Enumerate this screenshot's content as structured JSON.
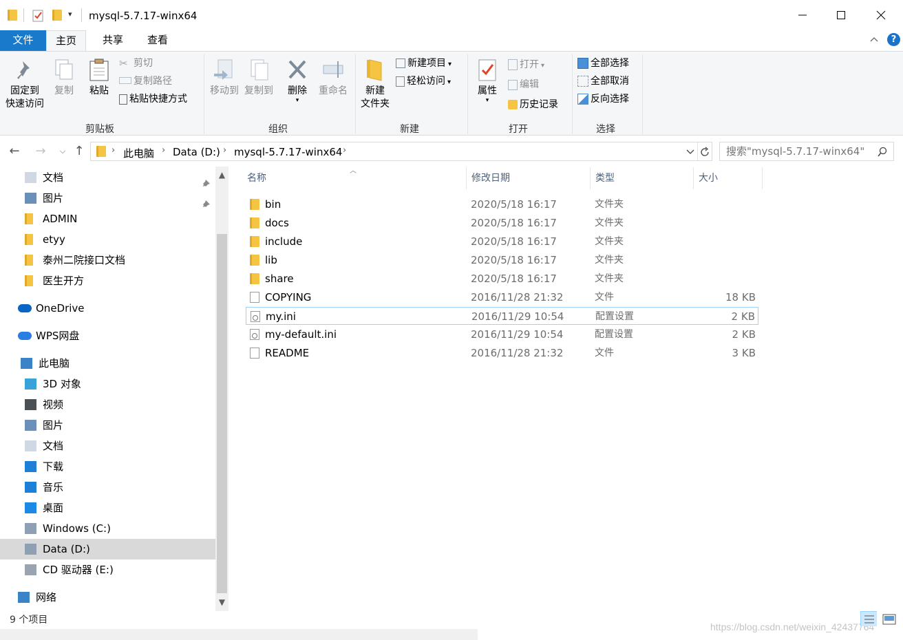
{
  "window": {
    "title": "mysql-5.7.17-winx64",
    "minimize_icon": "minimize-icon",
    "maximize_icon": "maximize-icon",
    "close_icon": "close-icon"
  },
  "tabs": {
    "file": "文件",
    "home": "主页",
    "share": "共享",
    "view": "查看",
    "help": "?"
  },
  "ribbon": {
    "clipboard": {
      "label": "剪贴板",
      "pin_line1": "固定到",
      "pin_line2": "快速访问",
      "copy": "复制",
      "paste": "粘贴",
      "cut": "剪切",
      "copy_path": "复制路径",
      "paste_shortcut": "粘贴快捷方式"
    },
    "organize": {
      "label": "组织",
      "move_to": "移动到",
      "copy_to": "复制到",
      "delete": "删除",
      "rename": "重命名"
    },
    "new": {
      "label": "新建",
      "new_folder_line1": "新建",
      "new_folder_line2": "文件夹",
      "new_item": "新建项目",
      "easy_access": "轻松访问"
    },
    "open": {
      "label": "打开",
      "properties": "属性",
      "open": "打开",
      "edit": "编辑",
      "history": "历史记录"
    },
    "select": {
      "label": "选择",
      "select_all": "全部选择",
      "select_none": "全部取消",
      "invert": "反向选择"
    }
  },
  "address": {
    "crumbs": [
      "此电脑",
      "Data (D:)",
      "mysql-5.7.17-winx64"
    ],
    "search_placeholder": "搜索\"mysql-5.7.17-winx64\""
  },
  "nav": {
    "items": [
      {
        "label": "文档",
        "icon": "documents-icon",
        "pinned": true
      },
      {
        "label": "图片",
        "icon": "pictures-icon",
        "pinned": true
      },
      {
        "label": "ADMIN",
        "icon": "folder-icon"
      },
      {
        "label": "etyy",
        "icon": "folder-icon"
      },
      {
        "label": "泰州二院接口文档",
        "icon": "folder-icon"
      },
      {
        "label": "医生开方",
        "icon": "folder-icon"
      },
      {
        "label": "OneDrive",
        "icon": "onedrive-icon"
      },
      {
        "label": "WPS网盘",
        "icon": "cloud-icon"
      },
      {
        "label": "此电脑",
        "icon": "computer-icon"
      },
      {
        "label": "3D 对象",
        "icon": "3d-objects-icon"
      },
      {
        "label": "视频",
        "icon": "videos-icon"
      },
      {
        "label": "图片",
        "icon": "pictures-icon"
      },
      {
        "label": "文档",
        "icon": "documents-icon"
      },
      {
        "label": "下载",
        "icon": "downloads-icon"
      },
      {
        "label": "音乐",
        "icon": "music-icon"
      },
      {
        "label": "桌面",
        "icon": "desktop-icon"
      },
      {
        "label": "Windows (C:)",
        "icon": "drive-c-icon"
      },
      {
        "label": "Data (D:)",
        "icon": "drive-d-icon",
        "selected": true
      },
      {
        "label": "CD 驱动器 (E:)",
        "icon": "cd-drive-icon"
      },
      {
        "label": "网络",
        "icon": "network-icon"
      }
    ]
  },
  "columns": {
    "name": "名称",
    "date": "修改日期",
    "type": "类型",
    "size": "大小"
  },
  "files": [
    {
      "name": "bin",
      "date": "2020/5/18 16:17",
      "type": "文件夹",
      "size": "",
      "icon": "folder-icon"
    },
    {
      "name": "docs",
      "date": "2020/5/18 16:17",
      "type": "文件夹",
      "size": "",
      "icon": "folder-icon"
    },
    {
      "name": "include",
      "date": "2020/5/18 16:17",
      "type": "文件夹",
      "size": "",
      "icon": "folder-icon"
    },
    {
      "name": "lib",
      "date": "2020/5/18 16:17",
      "type": "文件夹",
      "size": "",
      "icon": "folder-icon"
    },
    {
      "name": "share",
      "date": "2020/5/18 16:17",
      "type": "文件夹",
      "size": "",
      "icon": "folder-icon"
    },
    {
      "name": "COPYING",
      "date": "2016/11/28 21:32",
      "type": "文件",
      "size": "18 KB",
      "icon": "file-icon"
    },
    {
      "name": "my.ini",
      "date": "2016/11/29 10:54",
      "type": "配置设置",
      "size": "2 KB",
      "icon": "ini-file-icon",
      "focused": true
    },
    {
      "name": "my-default.ini",
      "date": "2016/11/29 10:54",
      "type": "配置设置",
      "size": "2 KB",
      "icon": "ini-file-icon"
    },
    {
      "name": "README",
      "date": "2016/11/28 21:32",
      "type": "文件",
      "size": "3 KB",
      "icon": "file-icon"
    }
  ],
  "status": {
    "count": "9 个项目"
  },
  "watermark": "https://blog.csdn.net/weixin_42437764",
  "colors": {
    "accent": "#1979ca",
    "selection": "#d9d9d9",
    "focus_border": "#99d1ff",
    "folder": "#f6c443"
  }
}
